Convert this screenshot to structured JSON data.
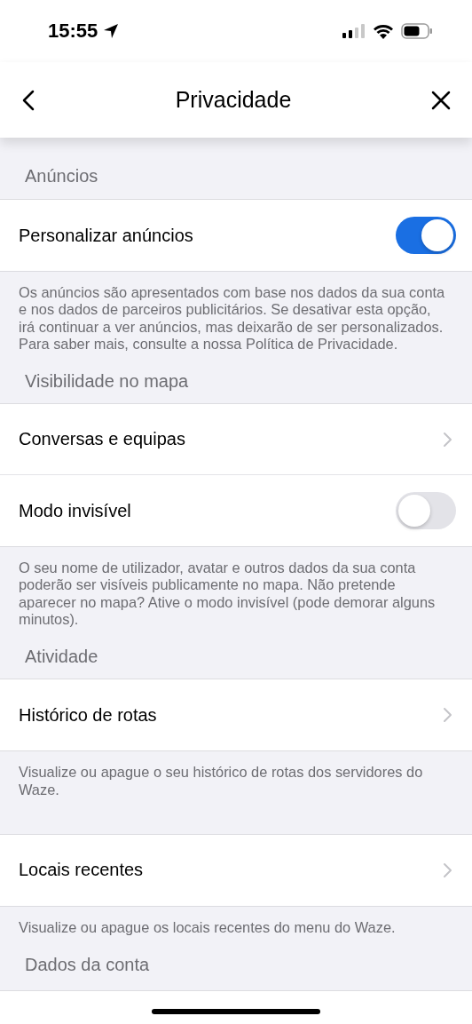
{
  "status_bar": {
    "time": "15:55"
  },
  "nav": {
    "title": "Privacidade"
  },
  "sections": [
    {
      "header": "Anúncios",
      "rows": [
        {
          "label": "Personalizar anúncios",
          "kind": "toggle",
          "on": true
        }
      ],
      "footnote": "Os anúncios são apresentados com base nos dados da sua conta e nos dados de parceiros publicitários. Se desativar esta opção, irá continuar a ver anúncios, mas deixarão de ser personalizados. Para saber mais, consulte a nossa Política de Privacidade."
    },
    {
      "header": "Visibilidade no mapa",
      "rows": [
        {
          "label": "Conversas e equipas",
          "kind": "link"
        },
        {
          "label": "Modo invisível",
          "kind": "toggle",
          "on": false
        }
      ],
      "footnote": "O seu nome de utilizador, avatar e outros dados da sua conta poderão ser visíveis publicamente no mapa. Não pretende aparecer no mapa? Ative o modo invisível (pode demorar alguns minutos)."
    },
    {
      "header": "Atividade",
      "rows": [
        {
          "label": "Histórico de rotas",
          "kind": "link"
        }
      ],
      "footnote": "Visualize ou apague o seu histórico de rotas dos servidores do Waze."
    },
    {
      "rows": [
        {
          "label": "Locais recentes",
          "kind": "link"
        }
      ],
      "footnote": "Visualize ou apague os locais recentes do menu do Waze."
    },
    {
      "header": "Dados da conta"
    }
  ]
}
